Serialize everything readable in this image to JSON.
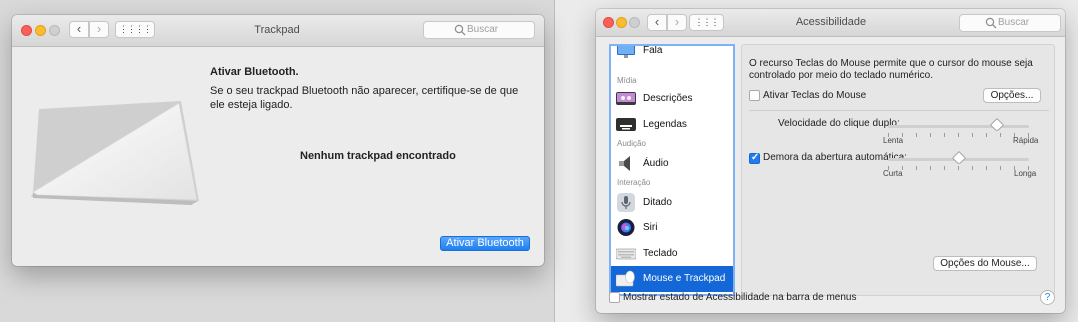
{
  "trackpad_window": {
    "title": "Trackpad",
    "search_placeholder": "Buscar",
    "heading": "Ativar Bluetooth.",
    "body": "Se o seu trackpad Bluetooth não aparecer, certifique-se de que ele esteja ligado.",
    "status": "Nenhum trackpad encontrado",
    "button": "Ativar Bluetooth"
  },
  "accessibility_window": {
    "title": "Acessibilidade",
    "search_placeholder": "Buscar",
    "sidebar": {
      "items": [
        {
          "label": "Fala",
          "icon": "speech-monitor-icon"
        },
        {
          "section": "Mídia"
        },
        {
          "label": "Descrições",
          "icon": "descriptions-icon"
        },
        {
          "label": "Legendas",
          "icon": "captions-icon"
        },
        {
          "section": "Audição"
        },
        {
          "label": "Áudio",
          "icon": "speaker-icon"
        },
        {
          "section": "Interação"
        },
        {
          "label": "Ditado",
          "icon": "microphone-icon"
        },
        {
          "label": "Siri",
          "icon": "siri-icon"
        },
        {
          "label": "Teclado",
          "icon": "keyboard-icon"
        },
        {
          "label": "Mouse e Trackpad",
          "icon": "mouse-trackpad-icon",
          "selected": true
        }
      ]
    },
    "panel": {
      "description": "O recurso Teclas do Mouse permite que o cursor do mouse seja controlado por meio do teclado numérico.",
      "enable_mouse_keys": {
        "label": "Ativar Teclas do Mouse",
        "checked": false
      },
      "options_button": "Opções...",
      "double_click_speed": {
        "label": "Velocidade do clique duplo:",
        "min_label": "Lenta",
        "max_label": "Rápida",
        "value": 0.77
      },
      "spring_loading_delay": {
        "label": "Demora da abertura automática:",
        "checked": true,
        "min_label": "Curta",
        "max_label": "Longa",
        "value": 0.5
      },
      "mouse_options_button": "Opções do Mouse..."
    },
    "footer": {
      "show_status_label": "Mostrar estado de Acessibilidade na barra de menus",
      "show_status_checked": false,
      "help": "?"
    }
  },
  "colors": {
    "selection": "#1367d6",
    "accent_blue": "#1f7cf0",
    "close": "#fc5f57",
    "minimize": "#fdbc2e"
  }
}
